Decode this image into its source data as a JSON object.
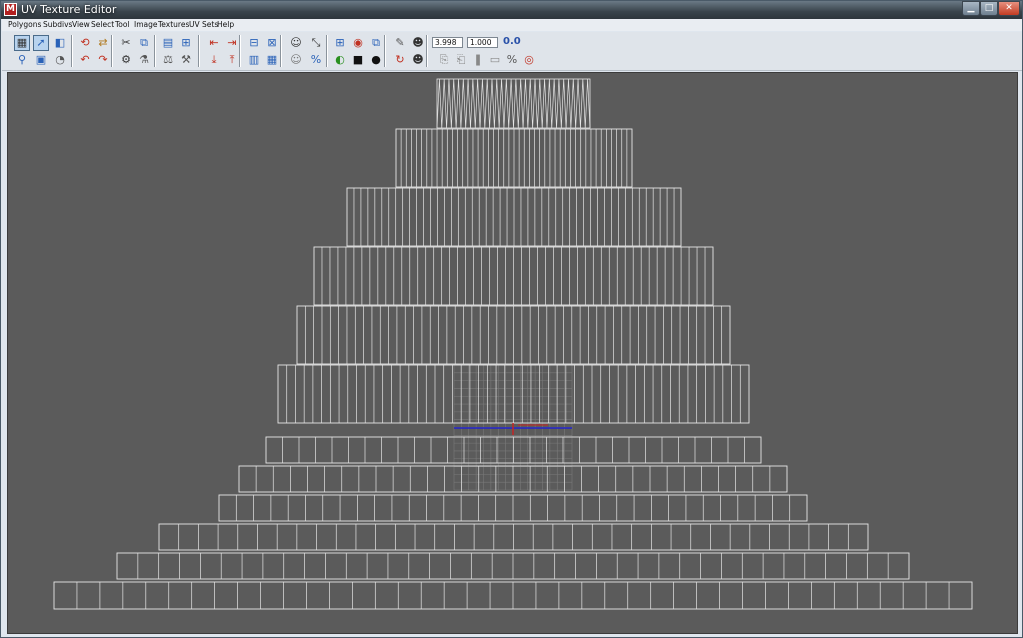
{
  "window": {
    "title": "UV Texture Editor",
    "app_icon": "maya-icon",
    "caption_buttons": [
      "minimize-icon",
      "maximize-icon",
      "close-icon"
    ],
    "minimize_glyph": "▁",
    "maximize_glyph": "□",
    "close_glyph": "✕"
  },
  "menu": [
    "Polygons",
    "Subdivs",
    "View",
    "Select",
    "Tool",
    "Image",
    "Textures",
    "UV Sets",
    "Help"
  ],
  "toolbar": {
    "field_1_value": "3.998",
    "field_2_value": "1.000",
    "toggle_label": "0.0",
    "icons": [
      "checker-icon",
      "move-uv-icon",
      "snapshot-icon",
      "rotate-uv-icon",
      "flip-uv-icon",
      "cut-uv-icon",
      "sew-uv-icon",
      "layout-icon",
      "grid-icon",
      "arrow-left-icon",
      "arrow-right-icon",
      "uv-grid-icon",
      "split-icon",
      "person-icon",
      "straighten-icon",
      "wire-grid-icon",
      "isolate-icon",
      "copy-uv-icon",
      "shell-icon",
      "camera-icon",
      "uv-ratio-icon",
      "dim-image-icon",
      "shade-icon",
      "percent-icon",
      "unfold-icon",
      "align-left-icon",
      "align-right-icon",
      "rotate-ccw-icon",
      "rotate-cw-icon",
      "normalize-icon",
      "relax-icon",
      "grid-sub-icon",
      "down-arrow-icon",
      "up-arrow-icon",
      "pin-icon",
      "refresh-icon",
      "paste-uv-icon",
      "cycle-icon",
      "texture-icon",
      "filter-icon",
      "copy-icon",
      "paste-icon",
      "delete-icon",
      "stack-icon",
      "distribute-icon",
      "unitize-icon"
    ]
  },
  "viewport": {
    "background": "#5b5b5b",
    "wire_color": "#e6e6e6",
    "grid_color": "#7a7a7a",
    "u_axis_color": "#2222cc",
    "v_axis_color": "#cc2222"
  }
}
